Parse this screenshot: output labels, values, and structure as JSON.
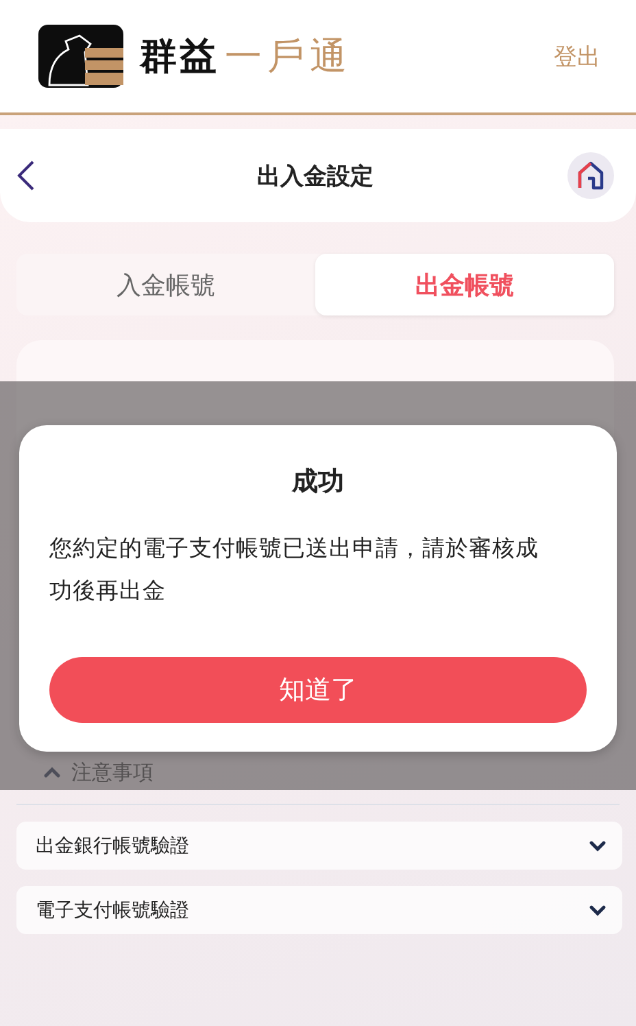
{
  "header": {
    "brand_primary": "群益",
    "brand_secondary": "一戶通",
    "logout": "登出"
  },
  "nav": {
    "title": "出入金設定"
  },
  "tabs": [
    {
      "label": "入金帳號",
      "selected": false
    },
    {
      "label": "出金帳號",
      "selected": true
    }
  ],
  "notes": {
    "label": "注意事項",
    "expanded": true
  },
  "accordions": [
    {
      "label": "出金銀行帳號驗證",
      "expanded": false
    },
    {
      "label": "電子支付帳號驗證",
      "expanded": false
    }
  ],
  "dialog": {
    "title": "成功",
    "message": "您約定的電子支付帳號已送出申請，請於審核成功後再出金",
    "button": "知道了"
  }
}
